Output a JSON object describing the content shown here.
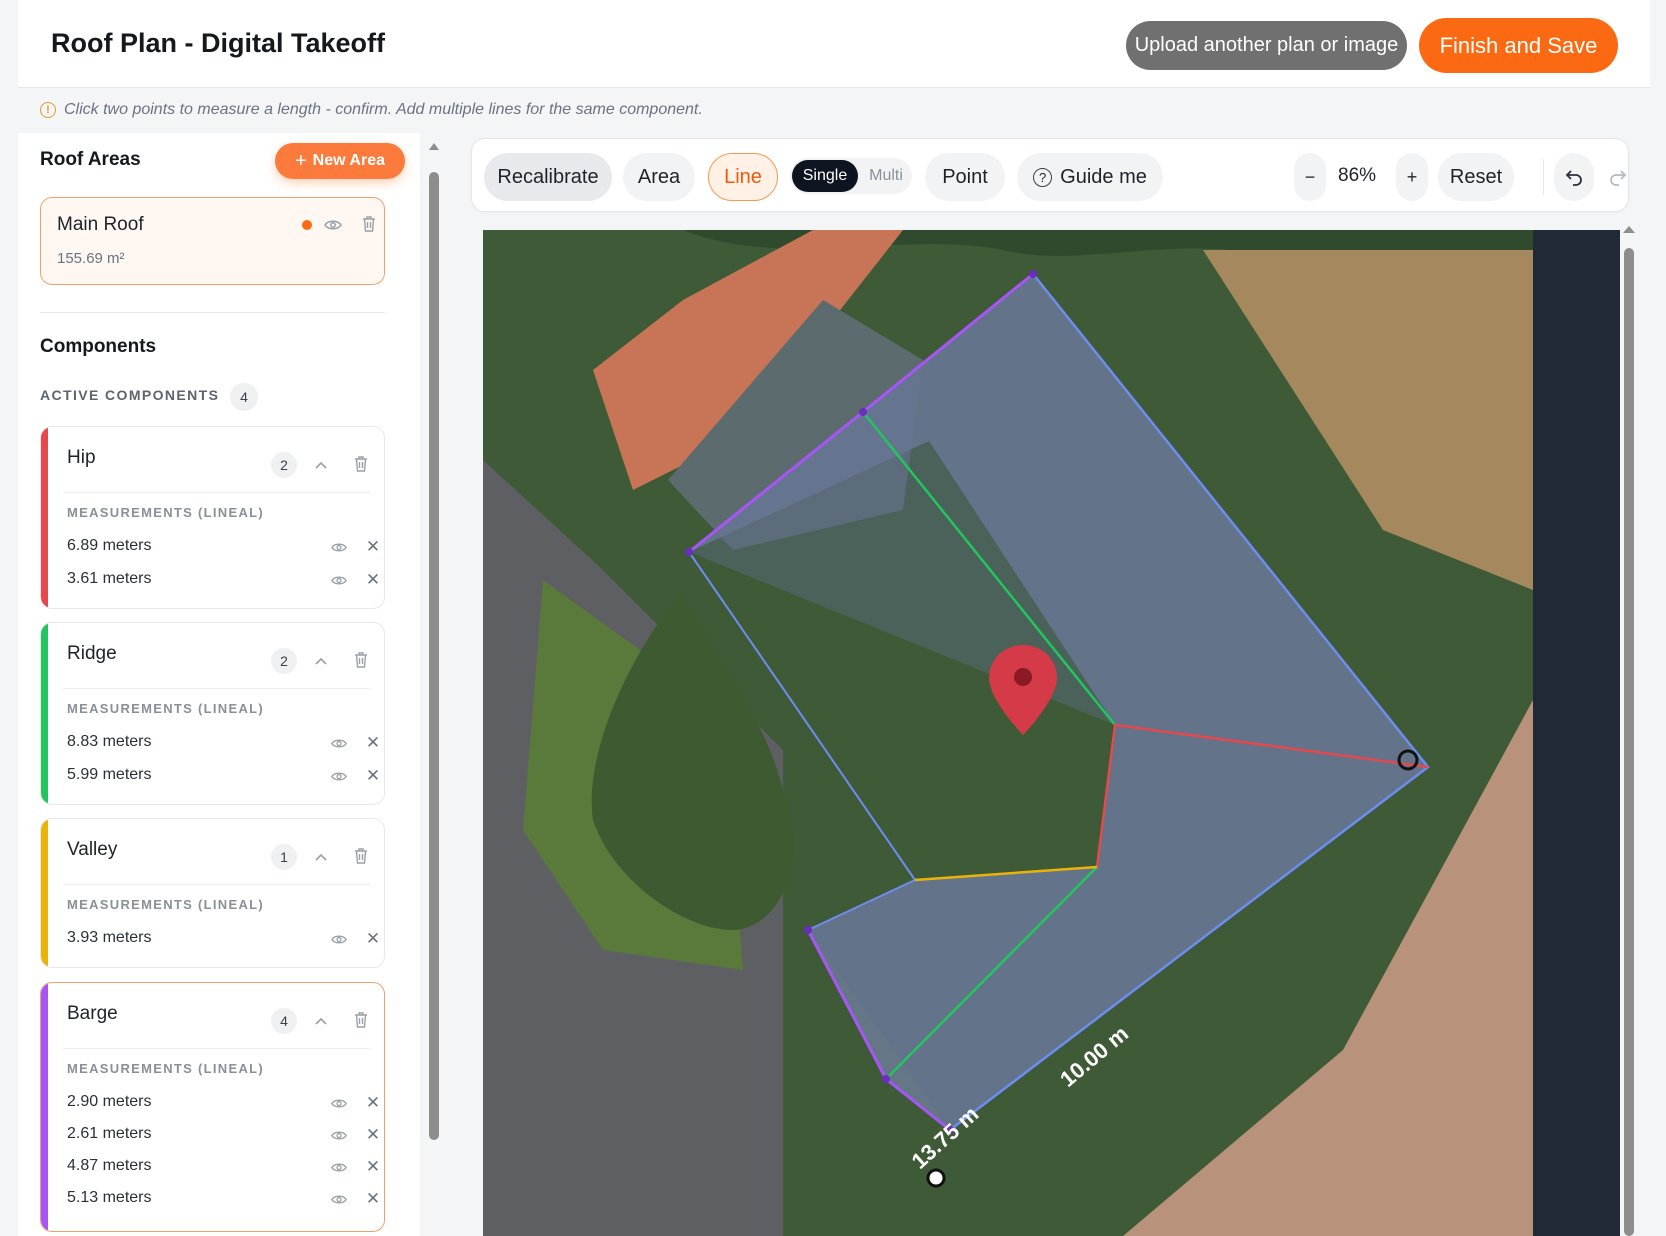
{
  "header": {
    "title": "Roof Plan - Digital Takeoff",
    "upload_label": "Upload another plan or image",
    "finish_label": "Finish and Save"
  },
  "hint": "Click two points to measure a length - confirm. Add multiple lines for the same component.",
  "sidebar": {
    "roof_areas_title": "Roof Areas",
    "new_area_label": "New Area",
    "area": {
      "name": "Main Roof",
      "size": "155.69 m²"
    },
    "components_title": "Components",
    "active_label": "ACTIVE COMPONENTS",
    "active_count": "4",
    "measurements_label": "MEASUREMENTS (LINEAL)",
    "components": [
      {
        "name": "Hip",
        "count": "2",
        "color": "#e5484d",
        "measurements": [
          "6.89 meters",
          "3.61 meters"
        ]
      },
      {
        "name": "Ridge",
        "count": "2",
        "color": "#22c55e",
        "measurements": [
          "8.83 meters",
          "5.99 meters"
        ]
      },
      {
        "name": "Valley",
        "count": "1",
        "color": "#eab308",
        "measurements": [
          "3.93 meters"
        ]
      },
      {
        "name": "Barge",
        "count": "4",
        "color": "#a855f7",
        "measurements": [
          "2.90 meters",
          "2.61 meters",
          "4.87 meters",
          "5.13 meters"
        ]
      }
    ]
  },
  "toolbar": {
    "recalibrate": "Recalibrate",
    "area": "Area",
    "line": "Line",
    "single": "Single",
    "multi": "Multi",
    "point": "Point",
    "guide": "Guide me",
    "zoom_out": "−",
    "zoom_level": "86%",
    "zoom_in": "+",
    "reset": "Reset"
  },
  "canvas": {
    "label_a": "10.00 m",
    "label_b": "13.75 m"
  },
  "colors": {
    "accent": "#fb6a12",
    "hip": "#e5484d",
    "ridge": "#22c55e",
    "valley": "#eab308",
    "barge": "#a855f7",
    "outline": "#6d8df0"
  }
}
